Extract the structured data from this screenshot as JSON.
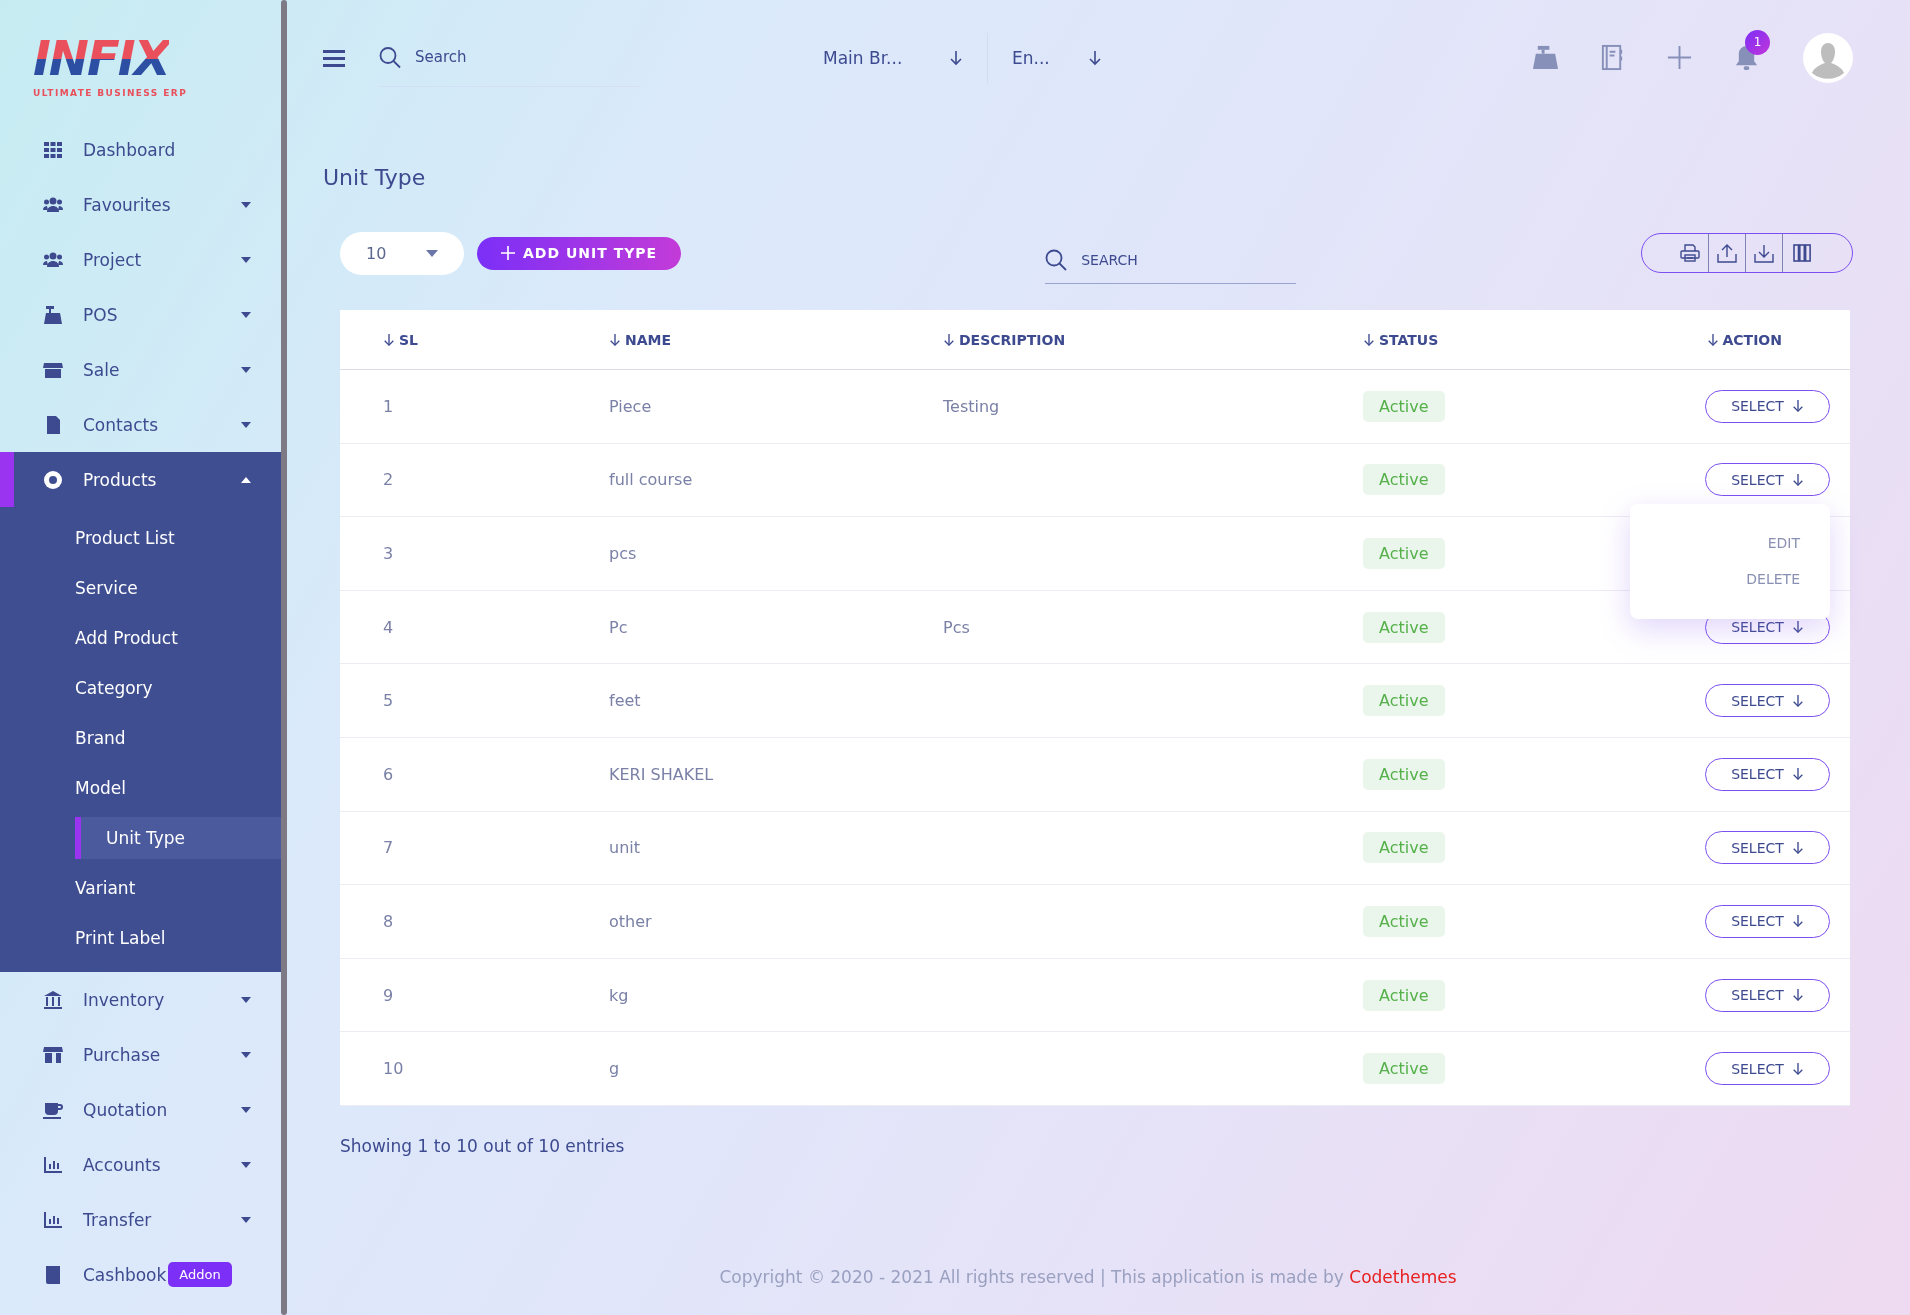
{
  "sidebar": {
    "logo": {
      "title": "INFIX",
      "subtitle": "ULTIMATE BUSINESS ERP"
    },
    "items": [
      {
        "label": "Dashboard",
        "kind": "link",
        "selected": false
      },
      {
        "label": "Favourites",
        "kind": "group",
        "selected": false,
        "expanded": false
      },
      {
        "label": "Project",
        "kind": "group",
        "selected": false,
        "expanded": false
      },
      {
        "label": "POS",
        "kind": "group",
        "selected": false,
        "expanded": false
      },
      {
        "label": "Sale",
        "kind": "group",
        "selected": false,
        "expanded": false
      },
      {
        "label": "Contacts",
        "kind": "group",
        "selected": false,
        "expanded": false
      },
      {
        "label": "Products",
        "kind": "group",
        "selected": true,
        "expanded": true,
        "children": [
          {
            "label": "Product List",
            "selected": false
          },
          {
            "label": "Service",
            "selected": false
          },
          {
            "label": "Add Product",
            "selected": false
          },
          {
            "label": "Category",
            "selected": false
          },
          {
            "label": "Brand",
            "selected": false
          },
          {
            "label": "Model",
            "selected": false
          },
          {
            "label": "Unit Type",
            "selected": true
          },
          {
            "label": "Variant",
            "selected": false
          },
          {
            "label": "Print Label",
            "selected": false
          }
        ]
      },
      {
        "label": "Inventory",
        "kind": "group",
        "selected": false,
        "expanded": false
      },
      {
        "label": "Purchase",
        "kind": "group",
        "selected": false,
        "expanded": false
      },
      {
        "label": "Quotation",
        "kind": "group",
        "selected": false,
        "expanded": false
      },
      {
        "label": "Accounts",
        "kind": "group",
        "selected": false,
        "expanded": false
      },
      {
        "label": "Transfer",
        "kind": "group",
        "selected": false,
        "expanded": false
      },
      {
        "label": "Cashbook",
        "kind": "link",
        "selected": false,
        "badge": "Addon"
      }
    ]
  },
  "header": {
    "search": {
      "placeholder": "Search"
    },
    "branch": "Main Br...",
    "language": "En...",
    "notification_count": "1"
  },
  "page": {
    "title": "Unit Type",
    "page_size": "10",
    "add_button": "ADD UNIT TYPE",
    "search": {
      "placeholder": "SEARCH"
    }
  },
  "table": {
    "columns": [
      "SL",
      "NAME",
      "DESCRIPTION",
      "STATUS",
      "ACTION"
    ],
    "action_menu": {
      "open": true,
      "items": [
        "EDIT",
        "DELETE"
      ]
    },
    "rows": [
      {
        "sl": "1",
        "name": "Piece",
        "description": "Testing",
        "status": "Active",
        "action": "SELECT"
      },
      {
        "sl": "2",
        "name": "full course",
        "status": "Active",
        "action": "SELECT"
      },
      {
        "sl": "3",
        "name": "pcs",
        "status": "Active"
      },
      {
        "sl": "4",
        "name": "Pc",
        "description": "Pcs",
        "status": "Active",
        "action": "SELECT"
      },
      {
        "sl": "5",
        "name": "feet",
        "status": "Active",
        "action": "SELECT"
      },
      {
        "sl": "6",
        "name": "KERI SHAKEL",
        "status": "Active",
        "action": "SELECT"
      },
      {
        "sl": "7",
        "name": "unit",
        "status": "Active",
        "action": "SELECT"
      },
      {
        "sl": "8",
        "name": "other",
        "status": "Active",
        "action": "SELECT"
      },
      {
        "sl": "9",
        "name": "kg",
        "status": "Active",
        "action": "SELECT"
      },
      {
        "sl": "10",
        "name": "g",
        "status": "Active",
        "action": "SELECT"
      }
    ]
  },
  "entries_info": "Showing 1 to 10 out of 10 entries",
  "footer": {
    "text": "Copyright © 2020 - 2021 All rights reserved | This application is made by ",
    "link": "Codethemes"
  }
}
